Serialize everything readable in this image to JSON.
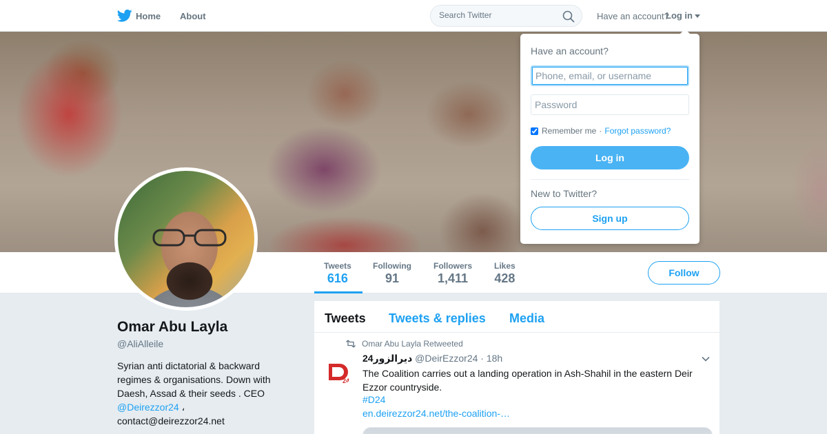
{
  "nav": {
    "logo_icon": "twitter-bird-icon",
    "home_label": "Home",
    "about_label": "About",
    "search_placeholder": "Search Twitter",
    "search_icon": "search-icon",
    "have_account": "Have an account?",
    "login_label": "Log in"
  },
  "login_dropdown": {
    "title": "Have an account?",
    "username_placeholder": "Phone, email, or username",
    "password_placeholder": "Password",
    "remember_label": "Remember me",
    "separator": "·",
    "forgot_label": "Forgot password?",
    "login_button": "Log in",
    "new_label": "New to Twitter?",
    "signup_button": "Sign up"
  },
  "stats": [
    {
      "label": "Tweets",
      "value": "616"
    },
    {
      "label": "Following",
      "value": "91"
    },
    {
      "label": "Followers",
      "value": "1,411"
    },
    {
      "label": "Likes",
      "value": "428"
    }
  ],
  "follow_button": "Follow",
  "profile": {
    "name": "Omar Abu Layla",
    "handle": "@AliAlleile",
    "bio_text": "Syrian anti dictatorial & backward regimes & organisations. Down with Daesh, Assad & their seeds . CEO",
    "bio_mention": "@Deirezzor24",
    "bio_sep": "،",
    "bio_email": "contact@deirezzor24.net"
  },
  "timeline": {
    "tabs": [
      "Tweets",
      "Tweets & replies",
      "Media"
    ],
    "tweet": {
      "retweet_context": "Omar Abu Layla Retweeted",
      "author_name": "24دیرالزور",
      "author_handle": "@DeirEzzor24",
      "time": "· 18h",
      "text": "The Coalition carries out a landing operation in Ash-Shahil in the eastern Deir Ezzor countryside.",
      "hashtag": "#D24",
      "link": "en.deirezzor24.net/the-coalition-…"
    }
  },
  "colors": {
    "brand_blue": "#1da1f2",
    "login_button": "#4ab3f4",
    "text_gray": "#657786",
    "background": "#e6ecf0"
  }
}
